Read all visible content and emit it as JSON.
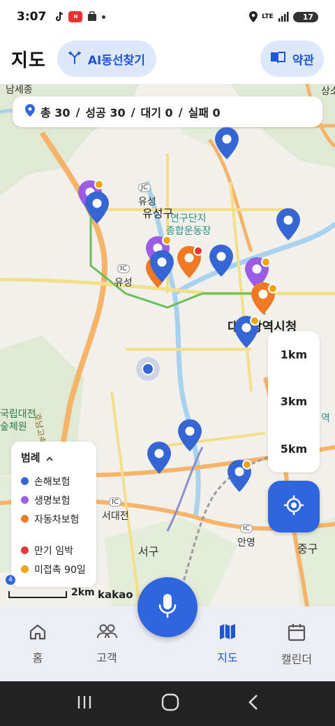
{
  "status_bar": {
    "time": "3:07",
    "app_icons": [
      "tiktok-icon",
      "news-icon",
      "shopping-icon"
    ],
    "network": "LTE",
    "battery": "17"
  },
  "header": {
    "title": "지도",
    "ai_button_label": "AI동선찾기",
    "terms_button_label": "약관"
  },
  "summary": {
    "total_label": "총 30",
    "success_label": "성공 30",
    "waiting_label": "대기 0",
    "failed_label": "실패 0",
    "separator": "/"
  },
  "map": {
    "labels": {
      "top_left_area": "남세종",
      "top_right_area": "상소",
      "jc_badge": "JC",
      "yuseong_small": "유성",
      "yuseong_gu": "유성구",
      "research_complex": "연구단지",
      "sports_ground": "종합운동장",
      "ic_badge_1": "IC",
      "yuseong_ic": "유성",
      "city_hall": "대전광역시청",
      "national_forest_1": "국립대전",
      "national_forest_2": "숲체원",
      "highway": "호남고속도로",
      "seodaejeon": "서대전",
      "seogu": "서구",
      "anyeong": "안영",
      "junggu": "중구",
      "ic_badge_2": "IC",
      "ic_badge_3": "IC",
      "station_right": "역"
    },
    "provider": "kakao",
    "scale_label": "2km",
    "scale_badge": "4"
  },
  "distance_options": [
    "1km",
    "3km",
    "5km"
  ],
  "legend": {
    "title": "범례",
    "items": [
      {
        "label": "손해보험",
        "color": "#3566d4"
      },
      {
        "label": "생명보험",
        "color": "#9b5de5"
      },
      {
        "label": "자동차보험",
        "color": "#f07a24"
      }
    ],
    "status_items": [
      {
        "label": "만기 임박",
        "color": "#e03a3a"
      },
      {
        "label": "미접촉 90일",
        "color": "#f2a413"
      }
    ]
  },
  "bottom_nav": [
    {
      "label": "홈",
      "icon": "home-icon",
      "active": false
    },
    {
      "label": "고객",
      "icon": "people-icon",
      "active": false
    },
    {
      "label": "지도",
      "icon": "map-icon",
      "active": true
    },
    {
      "label": "캘린더",
      "icon": "calendar-icon",
      "active": false
    }
  ],
  "colors": {
    "accent": "#2f66e0",
    "damage_insurance": "#3566d4",
    "life_insurance": "#9b5de5",
    "auto_insurance": "#f07a24",
    "expiring": "#e03a3a",
    "no_contact": "#f2a413"
  }
}
